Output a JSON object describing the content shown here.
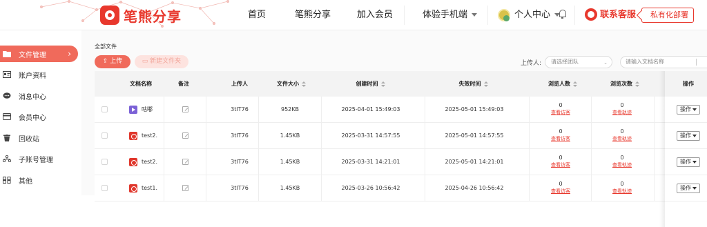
{
  "brand": {
    "name": "笔熊分享",
    "color": "#e8382d"
  },
  "nav": [
    {
      "label": "首页"
    },
    {
      "label": "笔熊分享"
    },
    {
      "label": "加入会员"
    },
    {
      "label": "体验手机端"
    }
  ],
  "user": {
    "label": "个人中心"
  },
  "support": {
    "label": "联系客服"
  },
  "deploy": {
    "label": "私有化部署"
  },
  "sidebar": [
    {
      "label": "文件管理",
      "icon": "folder-icon",
      "active": true
    },
    {
      "label": "账户资料",
      "icon": "id-card-icon"
    },
    {
      "label": "消息中心",
      "icon": "message-icon"
    },
    {
      "label": "会员中心",
      "icon": "card-icon"
    },
    {
      "label": "回收站",
      "icon": "trash-icon"
    },
    {
      "label": "子账号管理",
      "icon": "org-icon"
    },
    {
      "label": "其他",
      "icon": "grid-icon"
    }
  ],
  "page": {
    "breadcrumb": "全部文件",
    "upload_label": "上传",
    "new_folder_label": "新建文件夹",
    "uploader_label": "上传人:",
    "uploader_placeholder": "请选择团队",
    "search_placeholder": "请输入文档名称"
  },
  "table": {
    "headers": [
      "文档名称",
      "备注",
      "上传人",
      "文件大小",
      "创建时间",
      "失效时间",
      "浏览人数",
      "浏览次数",
      "操作"
    ],
    "rows": [
      {
        "type": "video",
        "name": "咕嘟",
        "uploader": "3tIT76",
        "size": "952KB",
        "created": "2025-04-01 15:49:03",
        "expires": "2025-05-01 15:49:03",
        "viewers": "0",
        "viewers_link": "查看访客",
        "views": "0",
        "views_link": "查看轨迹",
        "op": "操作"
      },
      {
        "type": "pdf",
        "name": "test2.",
        "uploader": "3tIT76",
        "size": "1.45KB",
        "created": "2025-03-31 14:57:55",
        "expires": "2025-05-01 14:57:55",
        "viewers": "0",
        "viewers_link": "查看访客",
        "views": "0",
        "views_link": "查看轨迹",
        "op": "操作"
      },
      {
        "type": "pdf",
        "name": "test2.",
        "uploader": "3tIT76",
        "size": "1.45KB",
        "created": "2025-03-31 14:21:01",
        "expires": "2025-05-01 14:21:01",
        "viewers": "0",
        "viewers_link": "查看访客",
        "views": "0",
        "views_link": "查看轨迹",
        "op": "操作"
      },
      {
        "type": "pdf",
        "name": "test1.",
        "uploader": "3tIT76",
        "size": "1.45KB",
        "created": "2025-03-26 10:56:42",
        "expires": "2025-04-26 10:56:42",
        "viewers": "0",
        "viewers_link": "查看访客",
        "views": "0",
        "views_link": "查看轨迹",
        "op": "操作"
      }
    ]
  }
}
